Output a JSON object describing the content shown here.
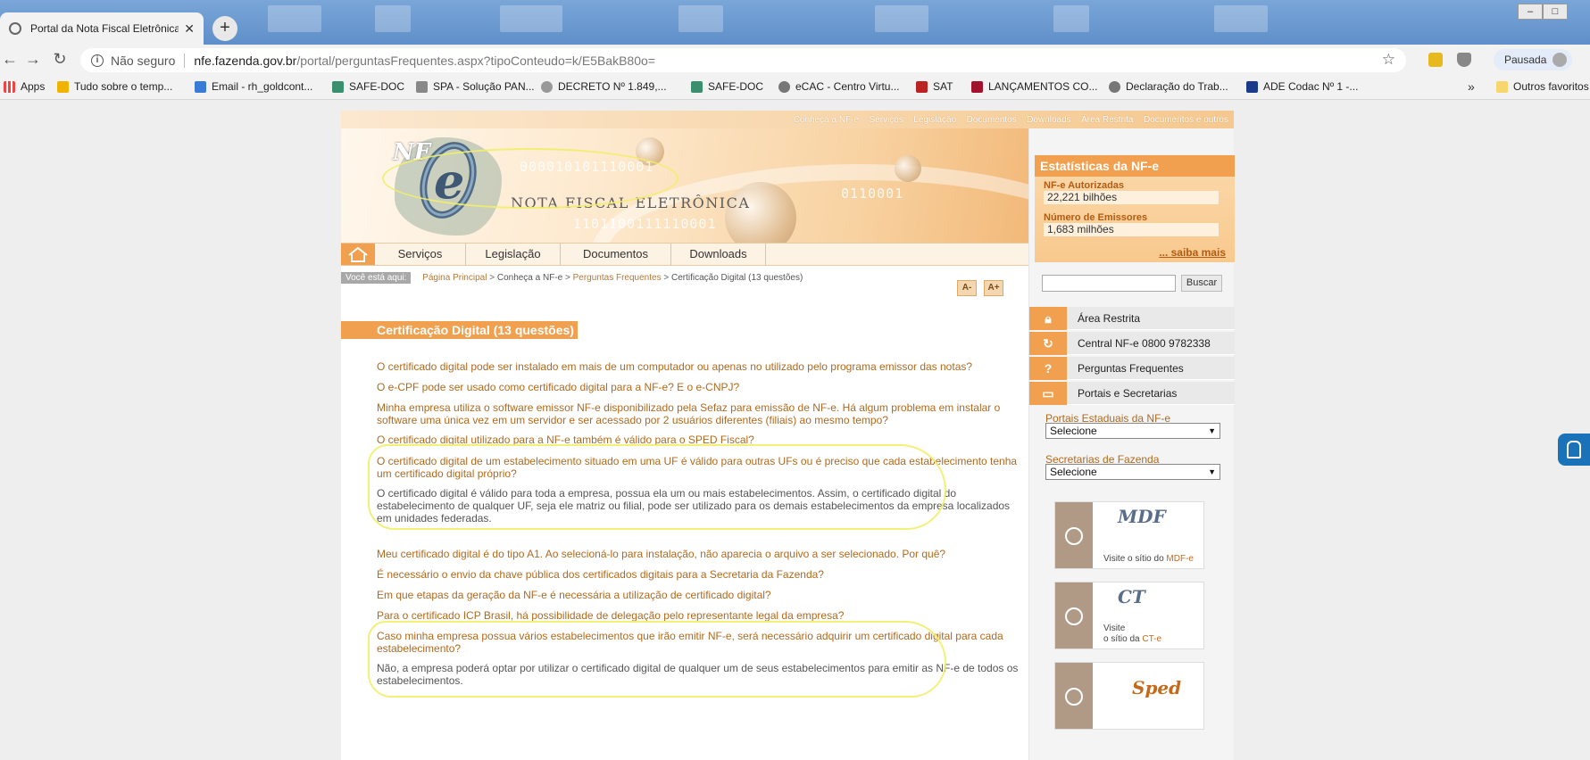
{
  "browser": {
    "tab_title": "Portal da Nota Fiscal Eletrônica",
    "tab_close": "✕",
    "new_tab": "+",
    "secure_label": "Não seguro",
    "url_host": "nfe.fazenda.gov.br",
    "url_path": "/portal/perguntasFrequentes.aspx?tipoConteudo=k/E5BakB80o=",
    "profile_label": "Pausada",
    "bookmarks": [
      "Apps",
      "Tudo sobre o temp...",
      "Email - rh_goldcont...",
      "SAFE-DOC",
      "SPA - Solução PAN...",
      "DECRETO Nº 1.849,...",
      "SAFE-DOC",
      "eCAC - Centro Virtu...",
      "SAT",
      "LANÇAMENTOS CO...",
      "Declaração do Trab...",
      "ADE Codac  Nº 1  -..."
    ],
    "bookmarks_more": "»",
    "other_bookmarks": "Outros favoritos"
  },
  "site": {
    "topnav": [
      "Conheça a NF-e",
      "Serviços",
      "Legislação",
      "Documentos",
      "Downloads",
      "Área Restrita",
      "Documentos e outros"
    ],
    "logo": {
      "nf": "NF",
      "tagline": "NOTA FISCAL ELETRÔNICA"
    },
    "mainnav": [
      "Serviços",
      "Legislação",
      "Documentos",
      "Downloads"
    ],
    "breadcrumb": {
      "label": "Você está aqui:",
      "items": [
        "Página Principal",
        "Conheça a NF-e",
        "Perguntas Frequentes"
      ],
      "current": "Certificação Digital (13 questões)",
      "sep": ">"
    },
    "font_minus": "A-",
    "font_plus": "A+",
    "heading": "Certificação Digital (13 questões)",
    "faq": [
      "O certificado digital pode ser instalado em mais de um computador ou apenas no utilizado pelo programa emissor das notas?",
      "O e-CPF pode ser usado como certificado digital para a NF-e? E o e-CNPJ?",
      "Minha empresa utiliza o software emissor NF-e disponibilizado pela Sefaz para emissão de NF-e. Há algum problema em instalar o software uma única vez em um servidor e ser acessado por 2 usuários diferentes (filiais) ao mesmo tempo?",
      "O certificado digital utilizado para a NF-e também é válido para o SPED Fiscal?",
      "O certificado digital de um estabelecimento situado em uma UF é válido para outras UFs ou é preciso que cada estabelecimento tenha um certificado digital próprio?",
      "O certificado digital é válido para toda a empresa, possua ela um ou mais estabelecimentos. Assim, o certificado digital do estabelecimento de qualquer UF, seja ele matriz ou filial, pode ser utilizado para os demais estabelecimentos da empresa localizados em unidades federadas.",
      "Meu certificado digital é do tipo A1. Ao selecioná-lo para instalação, não aparecia o arquivo a ser selecionado. Por quê?",
      "É necessário o envio da chave pública dos certificados digitais para a Secretaria da Fazenda?",
      "Em que etapas da geração da NF-e é necessária a utilização de certificado digital?",
      "Para o certificado ICP Brasil, há possibilidade de delegação pelo representante legal da empresa?",
      "Caso minha empresa possua vários estabelecimentos que irão emitir NF-e, será necessário adquirir um certificado digital para cada estabelecimento?",
      "Não, a empresa poderá optar por utilizar o certificado digital de qualquer um de seus estabelecimentos para emitir as NF-e de todos os estabelecimentos."
    ],
    "sidebar": {
      "stats_title": "Estatísticas da NF-e",
      "authorized_label": "NF-e Autorizadas",
      "authorized_value": "22,221 bilhões",
      "issuers_label": "Número de Emissores",
      "issuers_value": "1,683 milhões",
      "more_link": "... saiba mais",
      "search_button": "Buscar",
      "menu": [
        "Área Restrita",
        "Central NF-e 0800 9782338",
        "Perguntas Frequentes",
        "Portais e Secretarias"
      ],
      "state_portals_label": "Portais Estaduais da NF-e",
      "state_portals_value": "Selecione",
      "treasury_label": "Secretarias de Fazenda",
      "treasury_value": "Selecione",
      "promo_mdfe_mark": "MDF",
      "promo_mdfe_text": "Visite o sítio do",
      "promo_mdfe_link": "MDF-e",
      "promo_cte_mark": "CT",
      "promo_cte_text1": "Visite",
      "promo_cte_text2": "o sítio da",
      "promo_cte_link": "CT-e",
      "promo_sped_mark": "Sped"
    }
  }
}
